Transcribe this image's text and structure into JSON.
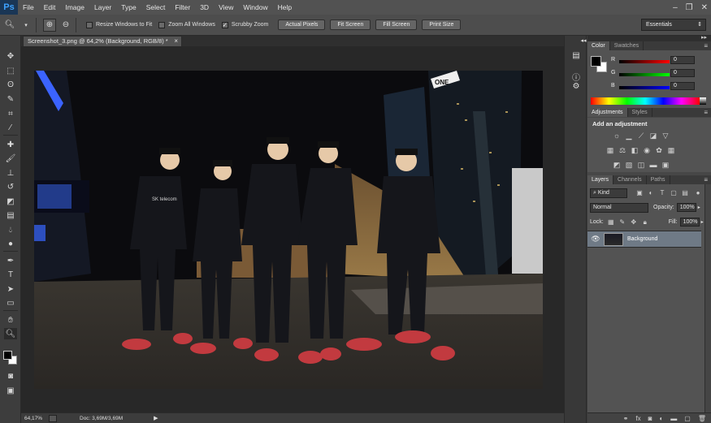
{
  "app": {
    "logo": "Ps"
  },
  "menu": [
    "File",
    "Edit",
    "Image",
    "Layer",
    "Type",
    "Select",
    "Filter",
    "3D",
    "View",
    "Window",
    "Help"
  ],
  "options": {
    "resize_windows": "Resize Windows to Fit",
    "zoom_all": "Zoom All Windows",
    "scrubby_zoom": "Scrubby Zoom",
    "actual_pixels": "Actual Pixels",
    "fit_screen": "Fit Screen",
    "fill_screen": "Fill Screen",
    "print_size": "Print Size",
    "workspace": "Essentials"
  },
  "document": {
    "tab_title": "Screenshot_3.png @ 64,2% (Background, RGB/8) *",
    "zoom": "64,17%",
    "doc_info": "Doc: 3,69M/3,69M"
  },
  "color_panel": {
    "tabs": [
      "Color",
      "Swatches"
    ],
    "r_label": "R",
    "g_label": "G",
    "b_label": "B",
    "r": "0",
    "g": "0",
    "b": "0"
  },
  "adjustments_panel": {
    "tabs": [
      "Adjustments",
      "Styles"
    ],
    "title": "Add an adjustment"
  },
  "layers_panel": {
    "tabs": [
      "Layers",
      "Channels",
      "Paths"
    ],
    "kind": "Kind",
    "blend_mode": "Normal",
    "opacity_label": "Opacity:",
    "opacity": "100%",
    "lock_label": "Lock:",
    "fill_label": "Fill:",
    "fill": "100%",
    "layer_name": "Background"
  },
  "photo_signs": {
    "one_way": "ONE",
    "sk_text_1": "SK telecom"
  }
}
